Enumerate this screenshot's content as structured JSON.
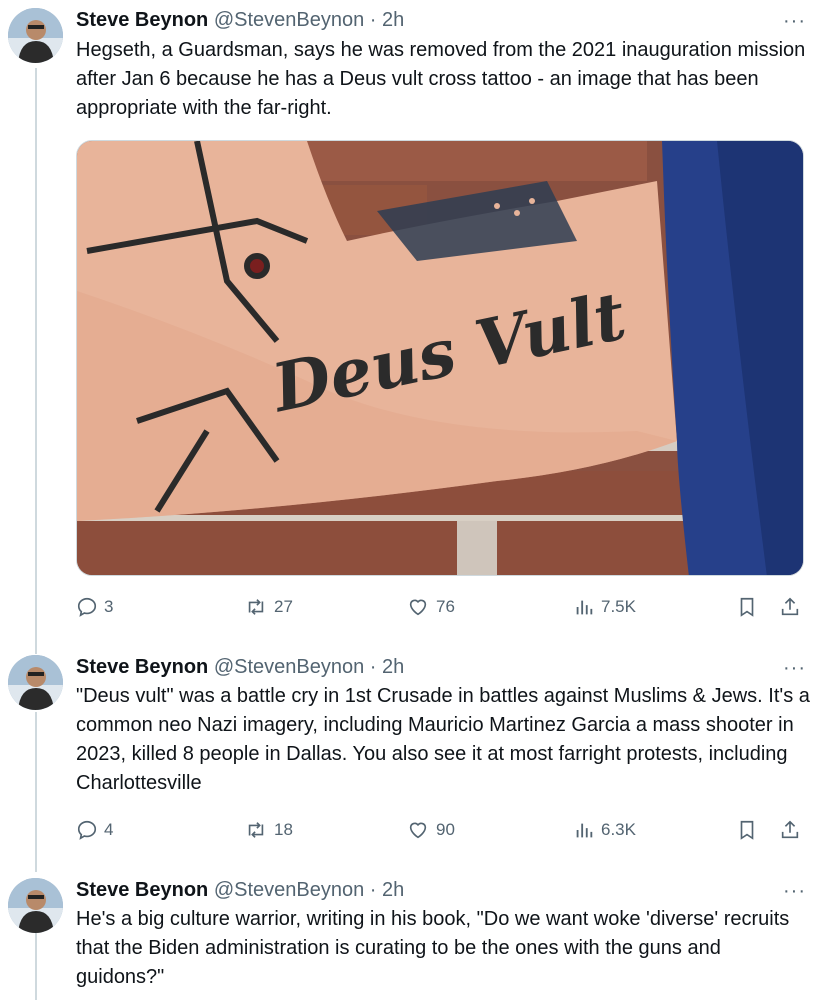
{
  "tweets": [
    {
      "name": "Steve Beynon",
      "handle": "@StevenBeynon",
      "time": "2h",
      "text": "Hegseth, a Guardsman, says he was removed from the 2021 inauguration mission after Jan 6 because he has a Deus vult cross tattoo - an image that has been appropriate with the far-right.",
      "media_tattoo_text": "Deus Vult",
      "replies": "3",
      "reposts": "27",
      "likes": "76",
      "views": "7.5K"
    },
    {
      "name": "Steve Beynon",
      "handle": "@StevenBeynon",
      "time": "2h",
      "text": "\"Deus vult\" was a battle cry in 1st Crusade in battles against Muslims & Jews. It's a common neo Nazi imagery, including Mauricio Martinez Garcia a mass shooter in 2023, killed 8 people in Dallas. You also see it at most farright protests, including Charlottesville",
      "replies": "4",
      "reposts": "18",
      "likes": "90",
      "views": "6.3K"
    },
    {
      "name": "Steve Beynon",
      "handle": "@StevenBeynon",
      "time": "2h",
      "text": "He's a big culture warrior, writing in his book, \"Do we want woke 'diverse' recruits that the Biden administration is curating to be the ones with the guns and guidons?\""
    }
  ],
  "separator": "·",
  "more_label": "···",
  "icons": [
    "reply-icon",
    "repost-icon",
    "like-icon",
    "views-icon",
    "bookmark-icon",
    "share-icon",
    "more-icon"
  ],
  "colors": {
    "text": "#0f1419",
    "secondary": "#536471",
    "thread_line": "#cfd9de"
  }
}
